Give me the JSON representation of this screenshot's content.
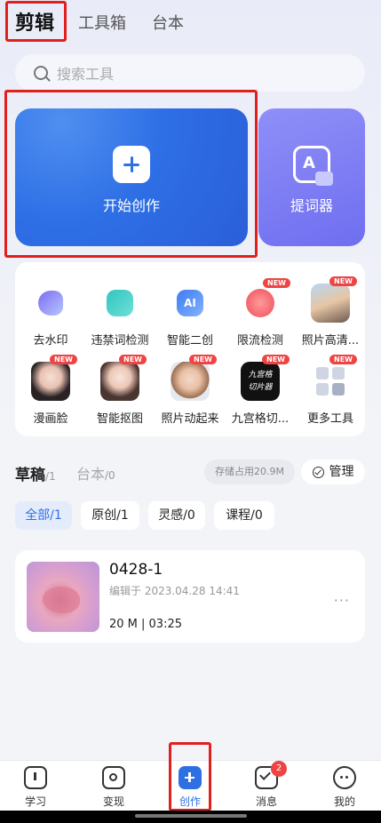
{
  "top_tabs": [
    {
      "label": "剪辑",
      "active": true
    },
    {
      "label": "工具箱",
      "active": false
    },
    {
      "label": "台本",
      "active": false
    }
  ],
  "search": {
    "placeholder": "搜索工具"
  },
  "create_card": {
    "label": "开始创作"
  },
  "prompter_card": {
    "label": "提词器"
  },
  "tools": [
    {
      "label": "去水印",
      "icon": "eraser-icon",
      "new": false
    },
    {
      "label": "违禁词检测",
      "icon": "text-check-icon",
      "new": false
    },
    {
      "label": "智能二创",
      "icon": "ai-icon",
      "new": false
    },
    {
      "label": "限流检测",
      "icon": "limit-check-icon",
      "new": true
    },
    {
      "label": "照片高清...",
      "icon": "photo-hd-icon",
      "new": true
    },
    {
      "label": "漫画脸",
      "icon": "comic-face-icon",
      "new": true
    },
    {
      "label": "智能抠图",
      "icon": "cutout-icon",
      "new": true
    },
    {
      "label": "照片动起来",
      "icon": "animate-photo-icon",
      "new": true
    },
    {
      "label": "九宫格切...",
      "icon": "grid-cut-icon",
      "new": true
    },
    {
      "label": "更多工具",
      "icon": "more-tools-icon",
      "new": true
    }
  ],
  "new_badge": "NEW",
  "drafts": {
    "tab_drafts": "草稿",
    "tab_drafts_count": "/1",
    "tab_scripts": "台本",
    "tab_scripts_count": "/0",
    "storage": "存储占用20.9M",
    "manage": "管理"
  },
  "filters": [
    {
      "label": "全部/1",
      "active": true
    },
    {
      "label": "原创/1",
      "active": false
    },
    {
      "label": "灵感/0",
      "active": false
    },
    {
      "label": "课程/0",
      "active": false
    }
  ],
  "draft_item": {
    "title": "0428-1",
    "edited": "编辑于 2023.04.28 14:41",
    "meta": "20 M | 03:25",
    "more": "···"
  },
  "bottom_nav": [
    {
      "label": "学习",
      "icon": "book-icon"
    },
    {
      "label": "变现",
      "icon": "monetize-icon"
    },
    {
      "label": "创作",
      "icon": "create-icon",
      "active": true
    },
    {
      "label": "消息",
      "icon": "message-icon",
      "badge": "2"
    },
    {
      "label": "我的",
      "icon": "profile-icon"
    }
  ],
  "colors": {
    "accent": "#2f6fe4",
    "highlight": "#e0201c"
  }
}
